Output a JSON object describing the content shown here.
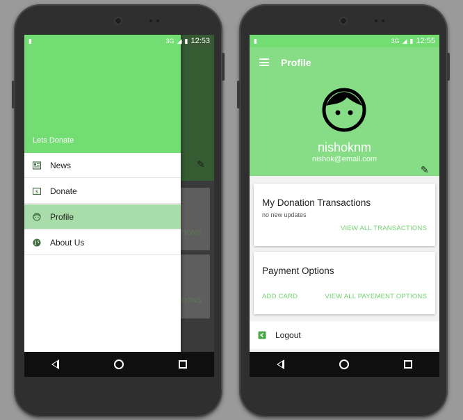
{
  "colors": {
    "accent_green": "#72dd72",
    "profile_header_green": "#86dd86",
    "drawer_active": "#a8dca8",
    "link_green": "#6fd46f"
  },
  "left_screen": {
    "status": {
      "time": "12:53",
      "network": "3G"
    },
    "drawer": {
      "header_title": "Lets Donate",
      "items": [
        {
          "label": "News",
          "icon": "news-icon",
          "active": false
        },
        {
          "label": "Donate",
          "icon": "donate-icon",
          "active": false
        },
        {
          "label": "Profile",
          "icon": "profile-icon",
          "active": true
        },
        {
          "label": "About Us",
          "icon": "globe-icon",
          "active": false
        }
      ]
    },
    "background_card_text_1": "TIONS",
    "background_card_text_2": "TIONS"
  },
  "right_screen": {
    "status": {
      "time": "12:55",
      "network": "3G"
    },
    "toolbar": {
      "title": "Profile"
    },
    "profile": {
      "name": "nishoknm",
      "email": "nishok@email.com"
    },
    "donation_card": {
      "title": "My Donation Transactions",
      "subtitle": "no new updates",
      "link": "VIEW ALL TRANSACTIONS"
    },
    "payment_card": {
      "title": "Payment Options",
      "add_card": "ADD CARD",
      "view_all": "VIEW ALL PAYEMENT OPTIONS"
    },
    "logout": {
      "label": "Logout"
    }
  }
}
